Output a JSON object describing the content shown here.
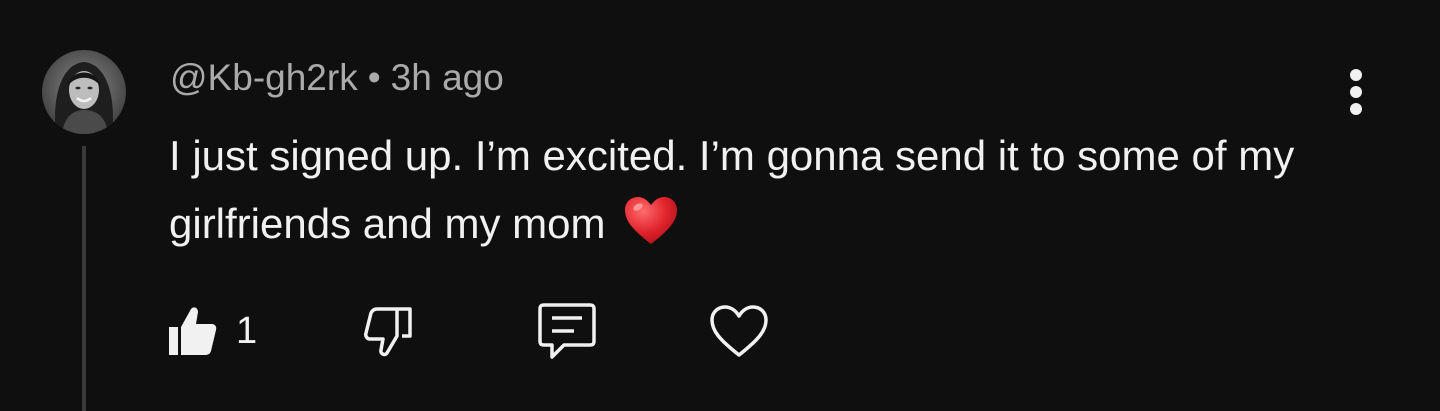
{
  "comment": {
    "author": "@Kb-gh2rk",
    "separator": "•",
    "time_ago": "3h ago",
    "text": "I just signed up. I’m excited. I’m gonna send it to some of my girlfriends and my mom",
    "emoji_name": "red-heart-emoji",
    "like_count": "1"
  },
  "icons": {
    "avatar": "user-avatar",
    "menu": "more-vert-icon",
    "like": "thumbs-up-filled-icon",
    "dislike": "thumbs-down-outline-icon",
    "reply": "comment-reply-icon",
    "heart": "heart-outline-icon"
  },
  "colors": {
    "background": "#0f0f0f",
    "primary_text": "#f1f1f1",
    "secondary_text": "#aaaaaa",
    "heart_emoji": "#e0242c",
    "thread_line": "#3a3a3a"
  }
}
